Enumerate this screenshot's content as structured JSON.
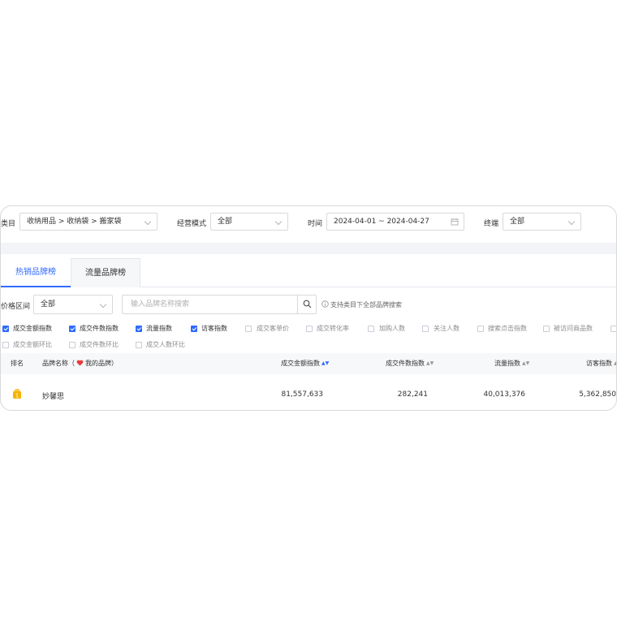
{
  "filters": {
    "category_label": "类目",
    "category_value": "收纳用品 > 收纳袋 > 搬家袋",
    "mode_label": "经营模式",
    "mode_value": "全部",
    "time_label": "时间",
    "time_value": "2024-04-01 ~ 2024-04-27",
    "terminal_label": "终端",
    "terminal_value": "全部"
  },
  "tabs": [
    {
      "label": "热销品牌榜",
      "active": true
    },
    {
      "label": "流量品牌榜",
      "active": false
    }
  ],
  "price": {
    "label": "价格区间",
    "value": "全部"
  },
  "search": {
    "placeholder": "输入品牌名称搜索",
    "hint": "支持类目下全部品牌搜索"
  },
  "metrics": [
    {
      "label": "成交金额指数",
      "checked": true
    },
    {
      "label": "成交件数指数",
      "checked": true
    },
    {
      "label": "流量指数",
      "checked": true
    },
    {
      "label": "访客指数",
      "checked": true
    },
    {
      "label": "成交客单价",
      "checked": false
    },
    {
      "label": "成交转化率",
      "checked": false
    },
    {
      "label": "加购人数",
      "checked": false
    },
    {
      "label": "关注人数",
      "checked": false
    },
    {
      "label": "搜索点击指数",
      "checked": false
    },
    {
      "label": "被访问商品数",
      "checked": false
    },
    {
      "label": "成交金额环比",
      "checked": false
    },
    {
      "label": "成交件数环比",
      "checked": false
    },
    {
      "label": "成交人数环比",
      "checked": false
    }
  ],
  "table": {
    "headers": {
      "rank": "排名",
      "brand": "品牌名称（",
      "mine": "我的品牌）",
      "sales_amount": "成交金额指数",
      "sales_count": "成交件数指数",
      "traffic": "流量指数",
      "visitors": "访客指数"
    },
    "rows": [
      {
        "rank_icon": "gold-medal-icon",
        "brand": "妙馨思",
        "sales_amount": "81,557,633",
        "sales_count": "282,241",
        "traffic": "40,013,376",
        "visitors": "5,362,850"
      }
    ]
  },
  "colors": {
    "accent": "#2f6bff",
    "heart": "#e83b3b",
    "medal": "#f5b301"
  }
}
